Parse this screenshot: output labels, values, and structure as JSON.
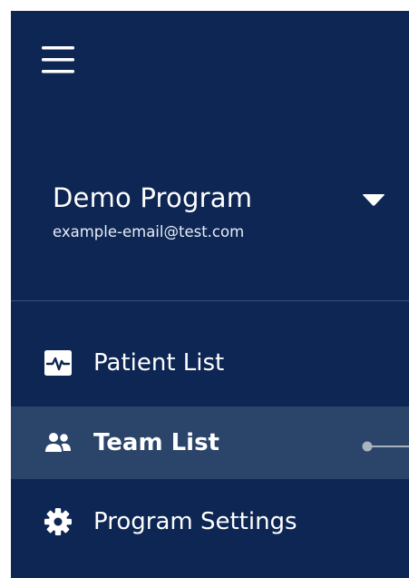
{
  "program": {
    "name": "Demo Program",
    "email": "example-email@test.com"
  },
  "nav": {
    "items": [
      {
        "label": "Patient List",
        "icon": "activity-icon",
        "active": false
      },
      {
        "label": "Team List",
        "icon": "users-icon",
        "active": true
      },
      {
        "label": "Program Settings",
        "icon": "gear-icon",
        "active": false
      }
    ]
  },
  "colors": {
    "sidebar_bg": "#0d2653",
    "active_item_bg": "#2b4469",
    "divider": "#3b5075",
    "text": "#ffffff"
  }
}
